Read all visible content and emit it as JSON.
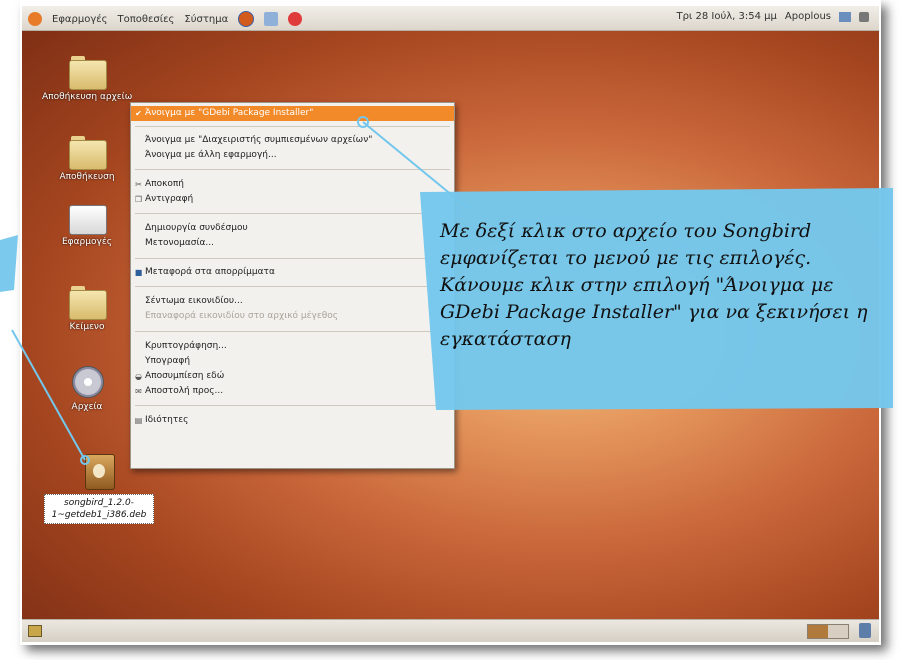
{
  "topbar": {
    "menus": [
      "Εφαρμογές",
      "Τοποθεσίες",
      "Σύστημα"
    ],
    "clock": "Τρι 28 Ιούλ, 3:54 μμ",
    "user": "Apoplous"
  },
  "desktop_icons": [
    {
      "label": "Αποθήκευση αρχείων"
    },
    {
      "label": "Αποθήκευση"
    },
    {
      "label": "Εφαρμογές"
    },
    {
      "label": "Κείμενο"
    },
    {
      "label": "Αρχεία"
    }
  ],
  "context_menu": {
    "items": [
      {
        "label": "Άνοιγμα με \"GDebi Package Installer\"",
        "icon": "check"
      },
      {
        "label": "Άνοιγμα με \"Διαχειριστής συμπιεσμένων αρχείων\""
      },
      {
        "label": "Άνοιγμα με άλλη εφαρμογή..."
      },
      {
        "label": "Αποκοπή",
        "icon": "scissors"
      },
      {
        "label": "Αντιγραφή",
        "icon": "copy"
      },
      {
        "label": "Δημιουργία συνδέσμου"
      },
      {
        "label": "Μετονομασία..."
      },
      {
        "label": "Μεταφορά στα απορρίμματα",
        "icon": "trash"
      },
      {
        "label": "Σέντωμα εικονιδίου..."
      },
      {
        "label": "Επαναφορά εικονιδίου στο αρχικό μέγεθος"
      },
      {
        "label": "Κρυπτογράφηση..."
      },
      {
        "label": "Υπογραφή"
      },
      {
        "label": "Αποσυμπίεση εδώ",
        "icon": "extract"
      },
      {
        "label": "Αποστολή προς...",
        "icon": "send"
      },
      {
        "label": "Ιδιότητες",
        "icon": "properties"
      }
    ]
  },
  "selected_file": {
    "label": "songbird_1.2.0-1~getdeb1_i386.deb"
  },
  "callout": {
    "text": "Με δεξί κλικ στο αρχείο του Songbird εμφανίζεται το μενού με τις επιλογές. Κάνουμε κλικ στην επιλογή \"Άνοιγμα με GDebi Package Installer\" για να ξεκινήσει η εγκατάσταση"
  },
  "colors": {
    "highlight": "#f28a2a",
    "callout_fill": "#74c7ec",
    "connector": "#74c7ec"
  }
}
